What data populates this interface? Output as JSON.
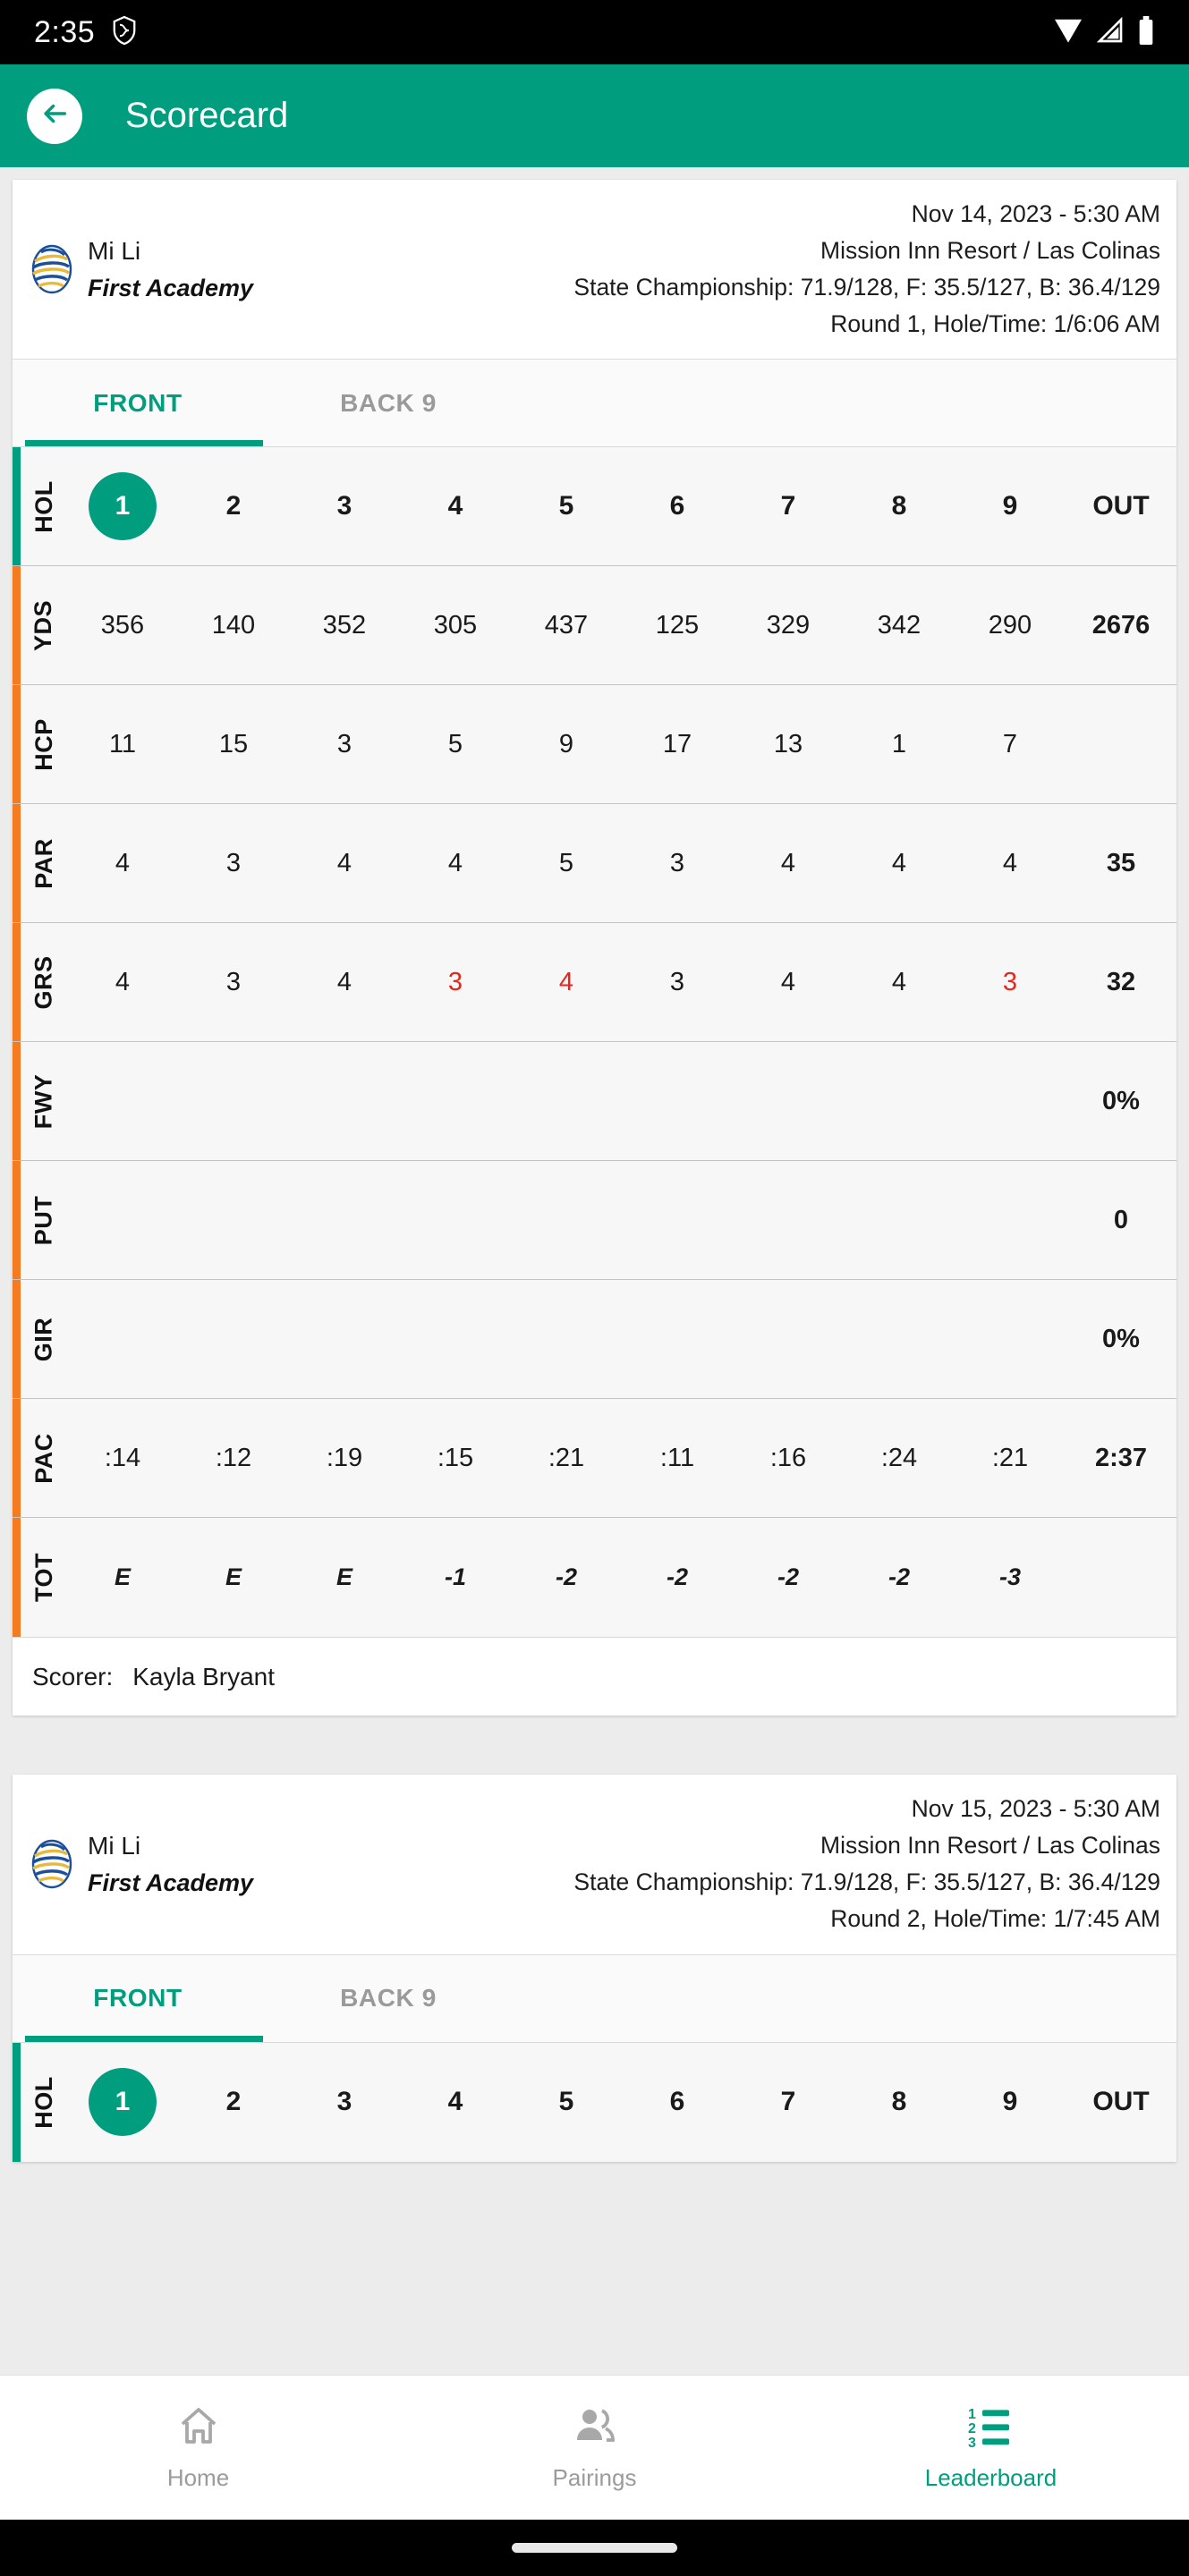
{
  "status_bar": {
    "time": "2:35",
    "left_icons": [
      "shield-icon"
    ],
    "right_icons": [
      "wifi-icon",
      "signal-icon",
      "battery-icon"
    ]
  },
  "app_bar": {
    "title": "Scorecard",
    "back_icon": "arrow-left-icon"
  },
  "colors": {
    "accent_green": "#009e7f",
    "accent_orange": "#f47b20",
    "under_par_red": "#e8251b",
    "inactive_gray": "#9b9b9b"
  },
  "cards": [
    {
      "player_name": "Mi Li",
      "team": "First Academy",
      "logo": "team-crest-icon",
      "date_time": "Nov 14, 2023 - 5:30 AM",
      "course": "Mission Inn Resort / Las Colinas",
      "tees": "State Championship: 71.9/128, F: 35.5/127, B: 36.4/129",
      "round_info": "Round 1, Hole/Time: 1/6:06 AM",
      "tabs": [
        {
          "label": "FRONT",
          "active": true
        },
        {
          "label": "BACK 9",
          "active": false
        }
      ],
      "rows": [
        {
          "label": "HOL",
          "accent": "green",
          "cells": [
            "1",
            "2",
            "3",
            "4",
            "5",
            "6",
            "7",
            "8",
            "9",
            "OUT"
          ],
          "current_hole_index": 0
        },
        {
          "label": "YDS",
          "accent": "orange",
          "cells": [
            "356",
            "140",
            "352",
            "305",
            "437",
            "125",
            "329",
            "342",
            "290",
            "2676"
          ]
        },
        {
          "label": "HCP",
          "accent": "orange",
          "cells": [
            "11",
            "15",
            "3",
            "5",
            "9",
            "17",
            "13",
            "1",
            "7",
            ""
          ]
        },
        {
          "label": "PAR",
          "accent": "orange",
          "cells": [
            "4",
            "3",
            "4",
            "4",
            "5",
            "3",
            "4",
            "4",
            "4",
            "35"
          ]
        },
        {
          "label": "GRS",
          "accent": "orange",
          "cells": [
            "4",
            "3",
            "4",
            "3",
            "4",
            "3",
            "4",
            "4",
            "3",
            "32"
          ],
          "red_indexes": [
            3,
            4,
            8
          ]
        },
        {
          "label": "FWY",
          "accent": "orange",
          "cells": [
            "",
            "",
            "",
            "",
            "",
            "",
            "",
            "",
            "",
            "0%"
          ]
        },
        {
          "label": "PUT",
          "accent": "orange",
          "cells": [
            "",
            "",
            "",
            "",
            "",
            "",
            "",
            "",
            "",
            "0"
          ]
        },
        {
          "label": "GIR",
          "accent": "orange",
          "cells": [
            "",
            "",
            "",
            "",
            "",
            "",
            "",
            "",
            "",
            "0%"
          ]
        },
        {
          "label": "PAC",
          "accent": "orange",
          "cells": [
            ":14",
            ":12",
            ":19",
            ":15",
            ":21",
            ":11",
            ":16",
            ":24",
            ":21",
            "2:37"
          ]
        },
        {
          "label": "TOT",
          "accent": "orange",
          "cells": [
            "E",
            "E",
            "E",
            "-1",
            "-2",
            "-2",
            "-2",
            "-2",
            "-3",
            ""
          ],
          "italic": true
        }
      ],
      "scorer_label": "Scorer:",
      "scorer_name": "Kayla Bryant"
    },
    {
      "player_name": "Mi Li",
      "team": "First Academy",
      "logo": "team-crest-icon",
      "date_time": "Nov 15, 2023 - 5:30 AM",
      "course": "Mission Inn Resort / Las Colinas",
      "tees": "State Championship: 71.9/128, F: 35.5/127, B: 36.4/129",
      "round_info": "Round 2, Hole/Time: 1/7:45 AM",
      "tabs": [
        {
          "label": "FRONT",
          "active": true
        },
        {
          "label": "BACK 9",
          "active": false
        }
      ],
      "rows": [
        {
          "label": "HOL",
          "accent": "green",
          "cells": [
            "1",
            "2",
            "3",
            "4",
            "5",
            "6",
            "7",
            "8",
            "9",
            "OUT"
          ],
          "current_hole_index": 0
        }
      ]
    }
  ],
  "bottom_nav": [
    {
      "label": "Home",
      "icon": "home-icon",
      "active": false
    },
    {
      "label": "Pairings",
      "icon": "people-icon",
      "active": false
    },
    {
      "label": "Leaderboard",
      "icon": "numbered-list-icon",
      "active": true
    }
  ]
}
